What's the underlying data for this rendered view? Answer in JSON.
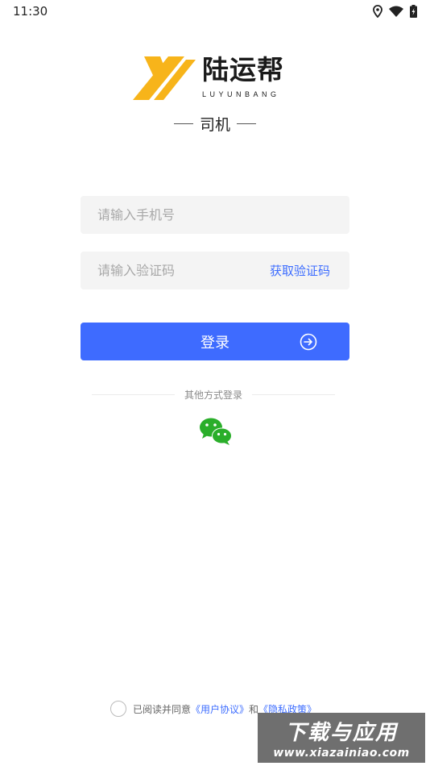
{
  "status_bar": {
    "time": "11:30",
    "icons": [
      "location-icon",
      "wifi-icon",
      "battery-charging-icon"
    ]
  },
  "logo": {
    "name_cn": "陆运帮",
    "name_en": "LUYUNBANG",
    "brand_color": "#f7b41a"
  },
  "role": {
    "label": "司机"
  },
  "form": {
    "phone_placeholder": "请输入手机号",
    "code_placeholder": "请输入验证码",
    "get_code_label": "获取验证码",
    "login_label": "登录"
  },
  "other_login": {
    "label": "其他方式登录",
    "methods": [
      "wechat-icon"
    ]
  },
  "agreement": {
    "prefix": "已阅读并同意",
    "user_agreement": "《用户协议》",
    "and": "和",
    "privacy_policy": "《隐私政策》"
  },
  "watermark": {
    "title": "下载与应用",
    "url": "www.xiazainiao.com"
  },
  "colors": {
    "primary": "#3e6bff",
    "link": "#3d6dff",
    "wechat": "#2aae2a"
  }
}
